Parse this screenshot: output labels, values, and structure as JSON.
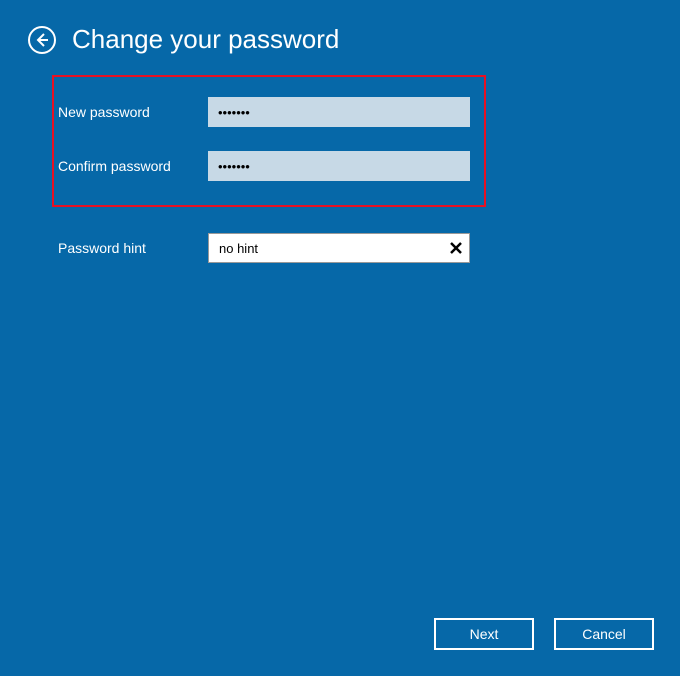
{
  "header": {
    "title": "Change your password"
  },
  "form": {
    "new_password": {
      "label": "New password",
      "value": "•••••••"
    },
    "confirm_password": {
      "label": "Confirm password",
      "value": "•••••••"
    },
    "hint": {
      "label": "Password hint",
      "value": "no hint"
    }
  },
  "buttons": {
    "next": "Next",
    "cancel": "Cancel"
  }
}
